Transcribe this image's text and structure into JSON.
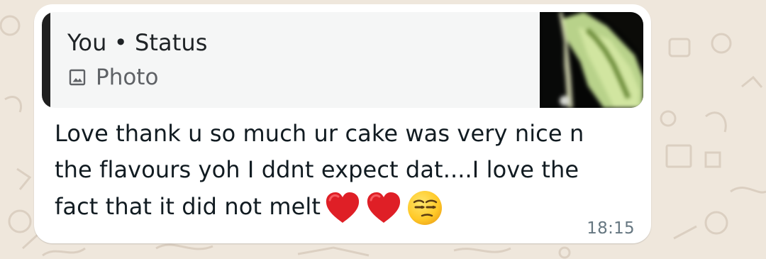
{
  "quoted_reply": {
    "title": "You • Status",
    "subtitle": "Photo",
    "subtitle_icon": "photo-icon",
    "thumbnail": "blurred-status-photo-thumbnail",
    "accent_bar_color": "#1f1f1f"
  },
  "message": {
    "line_1": "Love thank u so much ur cake was very nice n",
    "line_2": "the flavours yoh I ddnt expect dat....I love the",
    "line_3": "fact that it did not melt",
    "emojis": [
      "red-heart-emoji",
      "red-heart-emoji",
      "unamused-face-emoji"
    ],
    "timestamp": "18:15"
  },
  "colors": {
    "background": "#efe7dc",
    "bubble": "#ffffff",
    "quote_background": "#f5f6f6",
    "message_text": "#111b21",
    "secondary_text": "#5f6266",
    "timestamp_text": "#667781"
  }
}
